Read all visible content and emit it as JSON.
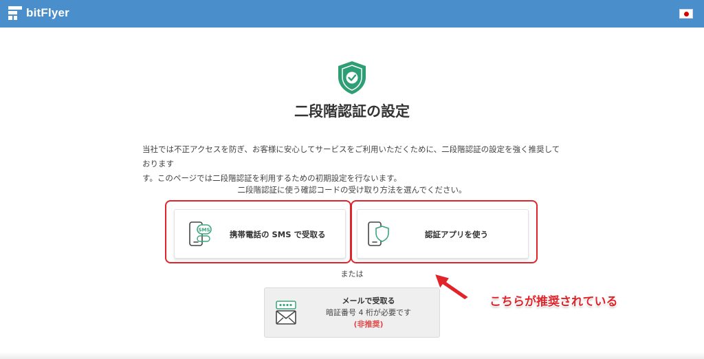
{
  "header": {
    "logo_text": "bitFlyer",
    "logo_icon": "bitflyer-logo-icon",
    "flag_icon": "japan-flag-icon"
  },
  "page": {
    "shield_icon": "shield-check-icon",
    "title": "二段階認証の設定",
    "description_line1": "当社では不正アクセスを防ぎ、お客様に安心してサービスをご利用いただくために、二段階認証の設定を強く推奨しております",
    "description_line2": "す。このページでは二段階認証を利用するための初期設定を行ないます。",
    "choose_prompt": "二段階認証に使う確認コードの受け取り方法を選んでください。"
  },
  "options": {
    "sms": {
      "label": "携帯電話の SMS で受取る",
      "icon": "phone-sms-icon",
      "icon_badge": "SMS"
    },
    "app": {
      "label": "認証アプリを使う",
      "icon": "phone-shield-icon"
    },
    "or_text": "または",
    "email": {
      "title": "メールで受取る",
      "note": "暗証番号 4 桁が必要です",
      "warning": "(非推奨)",
      "icon": "envelope-password-icon"
    }
  },
  "annotation": {
    "text": "こちらが推奨されている",
    "arrow_icon": "red-arrow-icon"
  },
  "colors": {
    "header_bg": "#4a8ecb",
    "shield_green": "#2e9e74",
    "icon_green": "#3aa57d",
    "highlight_red": "#e0242a",
    "warning_red": "#e04a4a"
  }
}
